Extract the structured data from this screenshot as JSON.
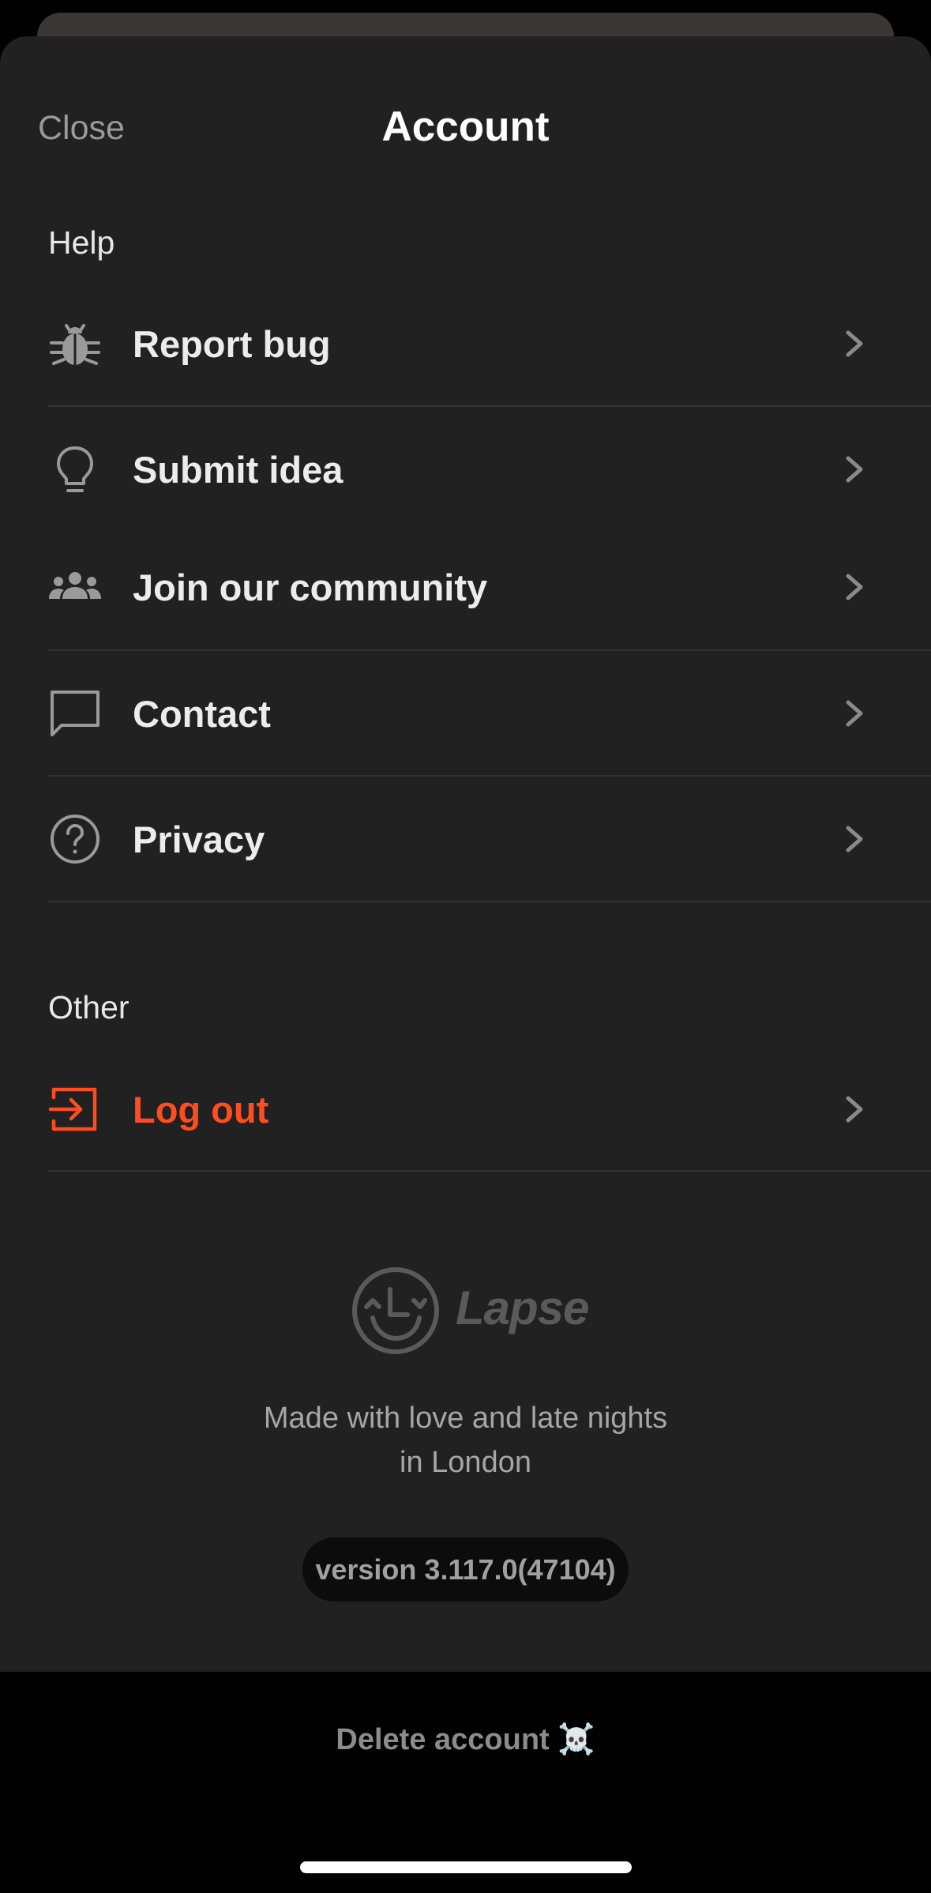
{
  "header": {
    "close_label": "Close",
    "title": "Account"
  },
  "sections": {
    "help": {
      "label": "Help",
      "items": [
        {
          "label": "Report bug",
          "icon": "bug-icon"
        },
        {
          "label": "Submit idea",
          "icon": "lightbulb-icon"
        },
        {
          "label": "Join our community",
          "icon": "community-icon"
        },
        {
          "label": "Contact",
          "icon": "chat-bubble-icon"
        },
        {
          "label": "Privacy",
          "icon": "question-circle-icon"
        }
      ]
    },
    "other": {
      "label": "Other",
      "items": [
        {
          "label": "Log out",
          "icon": "logout-icon"
        }
      ]
    }
  },
  "footer": {
    "brand_name": "Lapse",
    "tagline_line1": "Made with love and late nights",
    "tagline_line2": "in London",
    "version": "version 3.117.0(47104)",
    "delete_label": "Delete account ☠️"
  },
  "colors": {
    "sheet_background": "#212121",
    "accent_logout": "#ff4d1f",
    "text_primary": "#ececec",
    "text_muted": "#9a9a9a"
  }
}
